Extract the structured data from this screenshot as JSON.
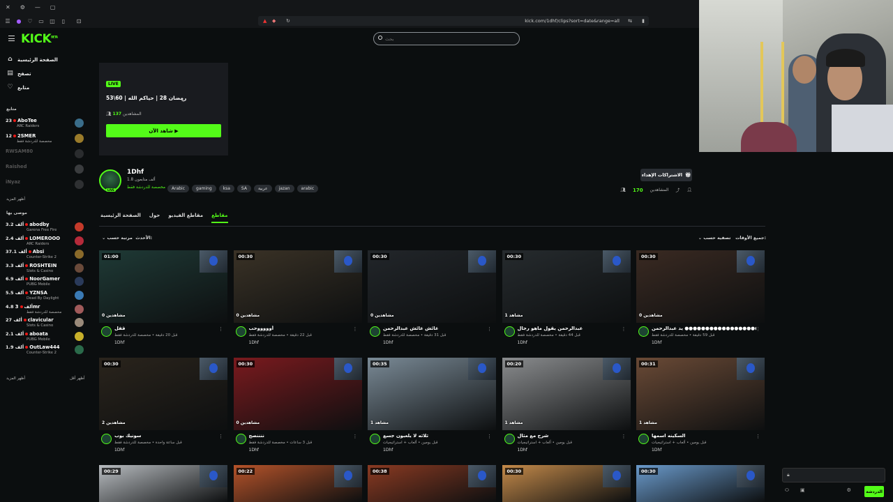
{
  "browser": {
    "url": "kick.com/1dhf/clips?sort=date&range=all"
  },
  "header": {
    "logo": "KICK",
    "logo_beta": "BETA",
    "search_placeholder": "بحث"
  },
  "sidebar": {
    "nav": [
      {
        "label": "الصفحة الرئيسية",
        "icon": "home-icon"
      },
      {
        "label": "تصفح",
        "icon": "browse-icon"
      },
      {
        "label": "متابع",
        "icon": "heart-icon"
      }
    ],
    "following_title": "متابع",
    "following": [
      {
        "count": "23",
        "name": "AboTee",
        "category": "ARC Raiders",
        "live": true,
        "avatar_color": "#3a6d8a"
      },
      {
        "count": "12",
        "name": "2SMER",
        "category": "مخصصة للدردشة فقط",
        "live": true,
        "avatar_color": "#9a7b2a"
      },
      {
        "name": "RWSAM80",
        "live": false,
        "avatar_color": "#2a2c2e"
      },
      {
        "name": "Raished",
        "live": false,
        "avatar_color": "#3a3c3e"
      },
      {
        "name": "iNyaz",
        "live": false,
        "avatar_color": "#2e3032"
      }
    ],
    "show_more": "أظهر المزيد",
    "recommended_title": "موصى بها",
    "recommended": [
      {
        "count": "3.2 ألف",
        "name": "abodby",
        "category": "Garena Free Fire",
        "avatar_color": "#c43a2a"
      },
      {
        "count": "2.4 ألف",
        "name": "LOMEROOO",
        "category": "ARC Raiders",
        "avatar_color": "#b52a3a"
      },
      {
        "count": "37.1 ألف",
        "name": "Absi",
        "category": "Counter-Strike 2",
        "avatar_color": "#8a6a2a"
      },
      {
        "count": "3.3 ألف",
        "name": "ROSHTEIN",
        "category": "Slots & Casino",
        "avatar_color": "#6a4a3a"
      },
      {
        "count": "6.9 ألف",
        "name": "NoorGamer",
        "category": "PUBG Mobile",
        "avatar_color": "#2a3a5a"
      },
      {
        "count": "5.5 ألف",
        "name": "YZNSA",
        "category": "Dead By Daylight",
        "avatar_color": "#3a7ab5"
      },
      {
        "count": "4.8 ألف",
        "name": "3mr",
        "category": "مخصصة للدردشة فقط",
        "avatar_color": "#a05a5a"
      },
      {
        "count": "27 ألف",
        "name": "clavicular",
        "category": "Slots & Casino",
        "avatar_color": "#9a8a7a"
      },
      {
        "count": "2.1 ألف",
        "name": "aboata",
        "category": "PUBG Mobile",
        "avatar_color": "#c8b02a"
      },
      {
        "count": "1.9 ألف",
        "name": "OutLaw444",
        "category": "Counter-Strike 2",
        "avatar_color": "#2a6a4a"
      }
    ],
    "show_more2": "أظهر المزيد",
    "show_less": "أظهر أقل"
  },
  "live_card": {
    "badge": "LIVE",
    "title": "رمضان 28 | حياكم الله | 60\\53",
    "viewers_label": "المشاهدين",
    "viewers": "137",
    "watch_button": "شاهد الآن ▶"
  },
  "channel": {
    "name": "1Dhf",
    "followers": "1.8 ألف متابعون",
    "category": "مخصصة للدردشة فقط",
    "avatar_badge": "LIVE",
    "tags": [
      "Arabic",
      "gaming",
      "ksa",
      "SA",
      "عربية",
      "jazan",
      "arabic"
    ],
    "subscribe_button": "الاشتراكات الإهداء",
    "viewers_count": "170",
    "viewers_label": "المشاهدين"
  },
  "tabs": [
    "الصفحة الرئيسية",
    "حول",
    "مقاطع الفيديو",
    "مقاطع"
  ],
  "active_tab": "مقاطع",
  "sort": {
    "label": "مرتبة حسب:",
    "value": "الأحدث"
  },
  "filter": {
    "label": "تصفية حسب:",
    "value": "جميع الأوقات"
  },
  "clips": [
    {
      "duration": "01:00",
      "views": "0 مشاهدين",
      "title": "قفل",
      "meta": "قبل 20 دقيقة • مخصصة للدردشة فقط",
      "by": "1Dhf",
      "scene": "#1f3a36"
    },
    {
      "duration": "00:30",
      "views": "0 مشاهدين",
      "title": "أوووووحب",
      "meta": "قبل 22 دقيقة • مخصصة للدردشة فقط",
      "by": "1Dhf",
      "scene": "#3a3226"
    },
    {
      "duration": "00:30",
      "views": "0 مشاهدين",
      "title": "عائش عائش عبدالرحمن",
      "meta": "قبل 31 دقيقة • مخصصة للدردشة فقط",
      "by": "1Dhf",
      "scene": "#22262a"
    },
    {
      "duration": "00:30",
      "views": "1 مشاهد",
      "title": "عبدالرحمن يقول ماهو رجال",
      "meta": "قبل 44 دقيقة • مخصصة للدردشة فقط",
      "by": "1Dhf",
      "scene": "#262b2e"
    },
    {
      "duration": "00:30",
      "views": "0 مشاهدين",
      "title": "يد عبدالرحمن ●●●●●●●●●●●●●●●●●●●",
      "meta": "قبل 59 دقيقة • مخصصة للدردشة فقط",
      "by": "1Dhf",
      "scene": "#3a2a22"
    },
    {
      "duration": "00:30",
      "views": "2 مشاهدين",
      "title": "سونيك بوب",
      "meta": "قبل ساعة واحدة • مخصصة للدردشة فقط",
      "by": "1Dhf",
      "scene": "#2a241c"
    },
    {
      "duration": "00:30",
      "views": "0 مشاهدين",
      "title": "ننننصح",
      "meta": "قبل 3 ساعات • مخصصة للدردشة فقط",
      "by": "1Dhf",
      "scene": "#7a1a1e"
    },
    {
      "duration": "00:35",
      "views": "1 مشاهد",
      "title": "ثلاثه لا يلعبون جسع",
      "meta": "قبل يومين • ألعاب + استراتيجيات",
      "by": "1Dhf",
      "scene": "#7a8a96"
    },
    {
      "duration": "00:20",
      "views": "1 مشاهد",
      "title": "شرح مع مثال",
      "meta": "قبل يومين • ألعاب + استراتيجيات",
      "by": "1Dhf",
      "scene": "#8a8c8e"
    },
    {
      "duration": "00:31",
      "views": "1 مشاهد",
      "title": "السكينه اسمها",
      "meta": "قبل يومين • ألعاب + استراتيجيات",
      "by": "1Dhf",
      "scene": "#6a4a36"
    },
    {
      "duration": "00:29",
      "views": "",
      "title": "",
      "meta": "",
      "by": "",
      "scene": "#b8bcc0"
    },
    {
      "duration": "00:22",
      "views": "",
      "title": "",
      "meta": "",
      "by": "",
      "scene": "#b5532a"
    },
    {
      "duration": "00:38",
      "views": "",
      "title": "",
      "meta": "",
      "by": "",
      "scene": "#8a3a22"
    },
    {
      "duration": "00:30",
      "views": "",
      "title": "",
      "meta": "",
      "by": "",
      "scene": "#c48a4a"
    },
    {
      "duration": "00:30",
      "views": "",
      "title": "",
      "meta": "",
      "by": "",
      "scene": "#6a9acb"
    }
  ],
  "chat": {
    "send_button": "الدردشة"
  }
}
